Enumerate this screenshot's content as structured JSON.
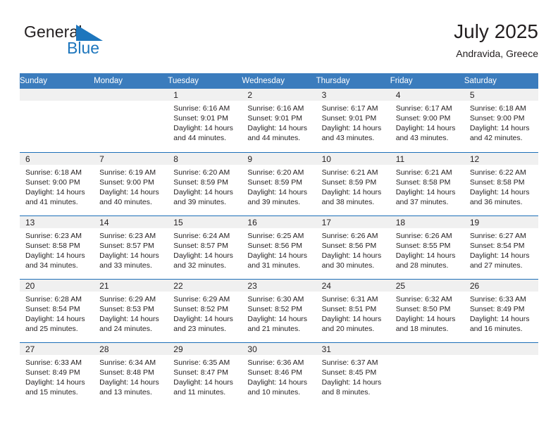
{
  "brand": {
    "name_top": "General",
    "name_bottom": "Blue",
    "flag_icon": "blue-triangle-flag-icon",
    "color_top": "#231f20",
    "color_bottom": "#1d76bd"
  },
  "header": {
    "title": "July 2025",
    "location": "Andravida, Greece"
  },
  "colors": {
    "header_blue": "#3b7cbd",
    "row_separator_blue": "#1d6fb8",
    "daynum_band": "#f0f0f0",
    "text": "#231f20"
  },
  "calendar": {
    "weekday_headers": [
      "Sunday",
      "Monday",
      "Tuesday",
      "Wednesday",
      "Thursday",
      "Friday",
      "Saturday"
    ],
    "weeks": [
      [
        {
          "day": "",
          "sunrise": "",
          "sunset": "",
          "daylight_line1": "",
          "daylight_line2": ""
        },
        {
          "day": "",
          "sunrise": "",
          "sunset": "",
          "daylight_line1": "",
          "daylight_line2": ""
        },
        {
          "day": "1",
          "sunrise": "Sunrise: 6:16 AM",
          "sunset": "Sunset: 9:01 PM",
          "daylight_line1": "Daylight: 14 hours",
          "daylight_line2": "and 44 minutes."
        },
        {
          "day": "2",
          "sunrise": "Sunrise: 6:16 AM",
          "sunset": "Sunset: 9:01 PM",
          "daylight_line1": "Daylight: 14 hours",
          "daylight_line2": "and 44 minutes."
        },
        {
          "day": "3",
          "sunrise": "Sunrise: 6:17 AM",
          "sunset": "Sunset: 9:01 PM",
          "daylight_line1": "Daylight: 14 hours",
          "daylight_line2": "and 43 minutes."
        },
        {
          "day": "4",
          "sunrise": "Sunrise: 6:17 AM",
          "sunset": "Sunset: 9:00 PM",
          "daylight_line1": "Daylight: 14 hours",
          "daylight_line2": "and 43 minutes."
        },
        {
          "day": "5",
          "sunrise": "Sunrise: 6:18 AM",
          "sunset": "Sunset: 9:00 PM",
          "daylight_line1": "Daylight: 14 hours",
          "daylight_line2": "and 42 minutes."
        }
      ],
      [
        {
          "day": "6",
          "sunrise": "Sunrise: 6:18 AM",
          "sunset": "Sunset: 9:00 PM",
          "daylight_line1": "Daylight: 14 hours",
          "daylight_line2": "and 41 minutes."
        },
        {
          "day": "7",
          "sunrise": "Sunrise: 6:19 AM",
          "sunset": "Sunset: 9:00 PM",
          "daylight_line1": "Daylight: 14 hours",
          "daylight_line2": "and 40 minutes."
        },
        {
          "day": "8",
          "sunrise": "Sunrise: 6:20 AM",
          "sunset": "Sunset: 8:59 PM",
          "daylight_line1": "Daylight: 14 hours",
          "daylight_line2": "and 39 minutes."
        },
        {
          "day": "9",
          "sunrise": "Sunrise: 6:20 AM",
          "sunset": "Sunset: 8:59 PM",
          "daylight_line1": "Daylight: 14 hours",
          "daylight_line2": "and 39 minutes."
        },
        {
          "day": "10",
          "sunrise": "Sunrise: 6:21 AM",
          "sunset": "Sunset: 8:59 PM",
          "daylight_line1": "Daylight: 14 hours",
          "daylight_line2": "and 38 minutes."
        },
        {
          "day": "11",
          "sunrise": "Sunrise: 6:21 AM",
          "sunset": "Sunset: 8:58 PM",
          "daylight_line1": "Daylight: 14 hours",
          "daylight_line2": "and 37 minutes."
        },
        {
          "day": "12",
          "sunrise": "Sunrise: 6:22 AM",
          "sunset": "Sunset: 8:58 PM",
          "daylight_line1": "Daylight: 14 hours",
          "daylight_line2": "and 36 minutes."
        }
      ],
      [
        {
          "day": "13",
          "sunrise": "Sunrise: 6:23 AM",
          "sunset": "Sunset: 8:58 PM",
          "daylight_line1": "Daylight: 14 hours",
          "daylight_line2": "and 34 minutes."
        },
        {
          "day": "14",
          "sunrise": "Sunrise: 6:23 AM",
          "sunset": "Sunset: 8:57 PM",
          "daylight_line1": "Daylight: 14 hours",
          "daylight_line2": "and 33 minutes."
        },
        {
          "day": "15",
          "sunrise": "Sunrise: 6:24 AM",
          "sunset": "Sunset: 8:57 PM",
          "daylight_line1": "Daylight: 14 hours",
          "daylight_line2": "and 32 minutes."
        },
        {
          "day": "16",
          "sunrise": "Sunrise: 6:25 AM",
          "sunset": "Sunset: 8:56 PM",
          "daylight_line1": "Daylight: 14 hours",
          "daylight_line2": "and 31 minutes."
        },
        {
          "day": "17",
          "sunrise": "Sunrise: 6:26 AM",
          "sunset": "Sunset: 8:56 PM",
          "daylight_line1": "Daylight: 14 hours",
          "daylight_line2": "and 30 minutes."
        },
        {
          "day": "18",
          "sunrise": "Sunrise: 6:26 AM",
          "sunset": "Sunset: 8:55 PM",
          "daylight_line1": "Daylight: 14 hours",
          "daylight_line2": "and 28 minutes."
        },
        {
          "day": "19",
          "sunrise": "Sunrise: 6:27 AM",
          "sunset": "Sunset: 8:54 PM",
          "daylight_line1": "Daylight: 14 hours",
          "daylight_line2": "and 27 minutes."
        }
      ],
      [
        {
          "day": "20",
          "sunrise": "Sunrise: 6:28 AM",
          "sunset": "Sunset: 8:54 PM",
          "daylight_line1": "Daylight: 14 hours",
          "daylight_line2": "and 25 minutes."
        },
        {
          "day": "21",
          "sunrise": "Sunrise: 6:29 AM",
          "sunset": "Sunset: 8:53 PM",
          "daylight_line1": "Daylight: 14 hours",
          "daylight_line2": "and 24 minutes."
        },
        {
          "day": "22",
          "sunrise": "Sunrise: 6:29 AM",
          "sunset": "Sunset: 8:52 PM",
          "daylight_line1": "Daylight: 14 hours",
          "daylight_line2": "and 23 minutes."
        },
        {
          "day": "23",
          "sunrise": "Sunrise: 6:30 AM",
          "sunset": "Sunset: 8:52 PM",
          "daylight_line1": "Daylight: 14 hours",
          "daylight_line2": "and 21 minutes."
        },
        {
          "day": "24",
          "sunrise": "Sunrise: 6:31 AM",
          "sunset": "Sunset: 8:51 PM",
          "daylight_line1": "Daylight: 14 hours",
          "daylight_line2": "and 20 minutes."
        },
        {
          "day": "25",
          "sunrise": "Sunrise: 6:32 AM",
          "sunset": "Sunset: 8:50 PM",
          "daylight_line1": "Daylight: 14 hours",
          "daylight_line2": "and 18 minutes."
        },
        {
          "day": "26",
          "sunrise": "Sunrise: 6:33 AM",
          "sunset": "Sunset: 8:49 PM",
          "daylight_line1": "Daylight: 14 hours",
          "daylight_line2": "and 16 minutes."
        }
      ],
      [
        {
          "day": "27",
          "sunrise": "Sunrise: 6:33 AM",
          "sunset": "Sunset: 8:49 PM",
          "daylight_line1": "Daylight: 14 hours",
          "daylight_line2": "and 15 minutes."
        },
        {
          "day": "28",
          "sunrise": "Sunrise: 6:34 AM",
          "sunset": "Sunset: 8:48 PM",
          "daylight_line1": "Daylight: 14 hours",
          "daylight_line2": "and 13 minutes."
        },
        {
          "day": "29",
          "sunrise": "Sunrise: 6:35 AM",
          "sunset": "Sunset: 8:47 PM",
          "daylight_line1": "Daylight: 14 hours",
          "daylight_line2": "and 11 minutes."
        },
        {
          "day": "30",
          "sunrise": "Sunrise: 6:36 AM",
          "sunset": "Sunset: 8:46 PM",
          "daylight_line1": "Daylight: 14 hours",
          "daylight_line2": "and 10 minutes."
        },
        {
          "day": "31",
          "sunrise": "Sunrise: 6:37 AM",
          "sunset": "Sunset: 8:45 PM",
          "daylight_line1": "Daylight: 14 hours",
          "daylight_line2": "and 8 minutes."
        },
        {
          "day": "",
          "sunrise": "",
          "sunset": "",
          "daylight_line1": "",
          "daylight_line2": ""
        },
        {
          "day": "",
          "sunrise": "",
          "sunset": "",
          "daylight_line1": "",
          "daylight_line2": ""
        }
      ]
    ]
  }
}
